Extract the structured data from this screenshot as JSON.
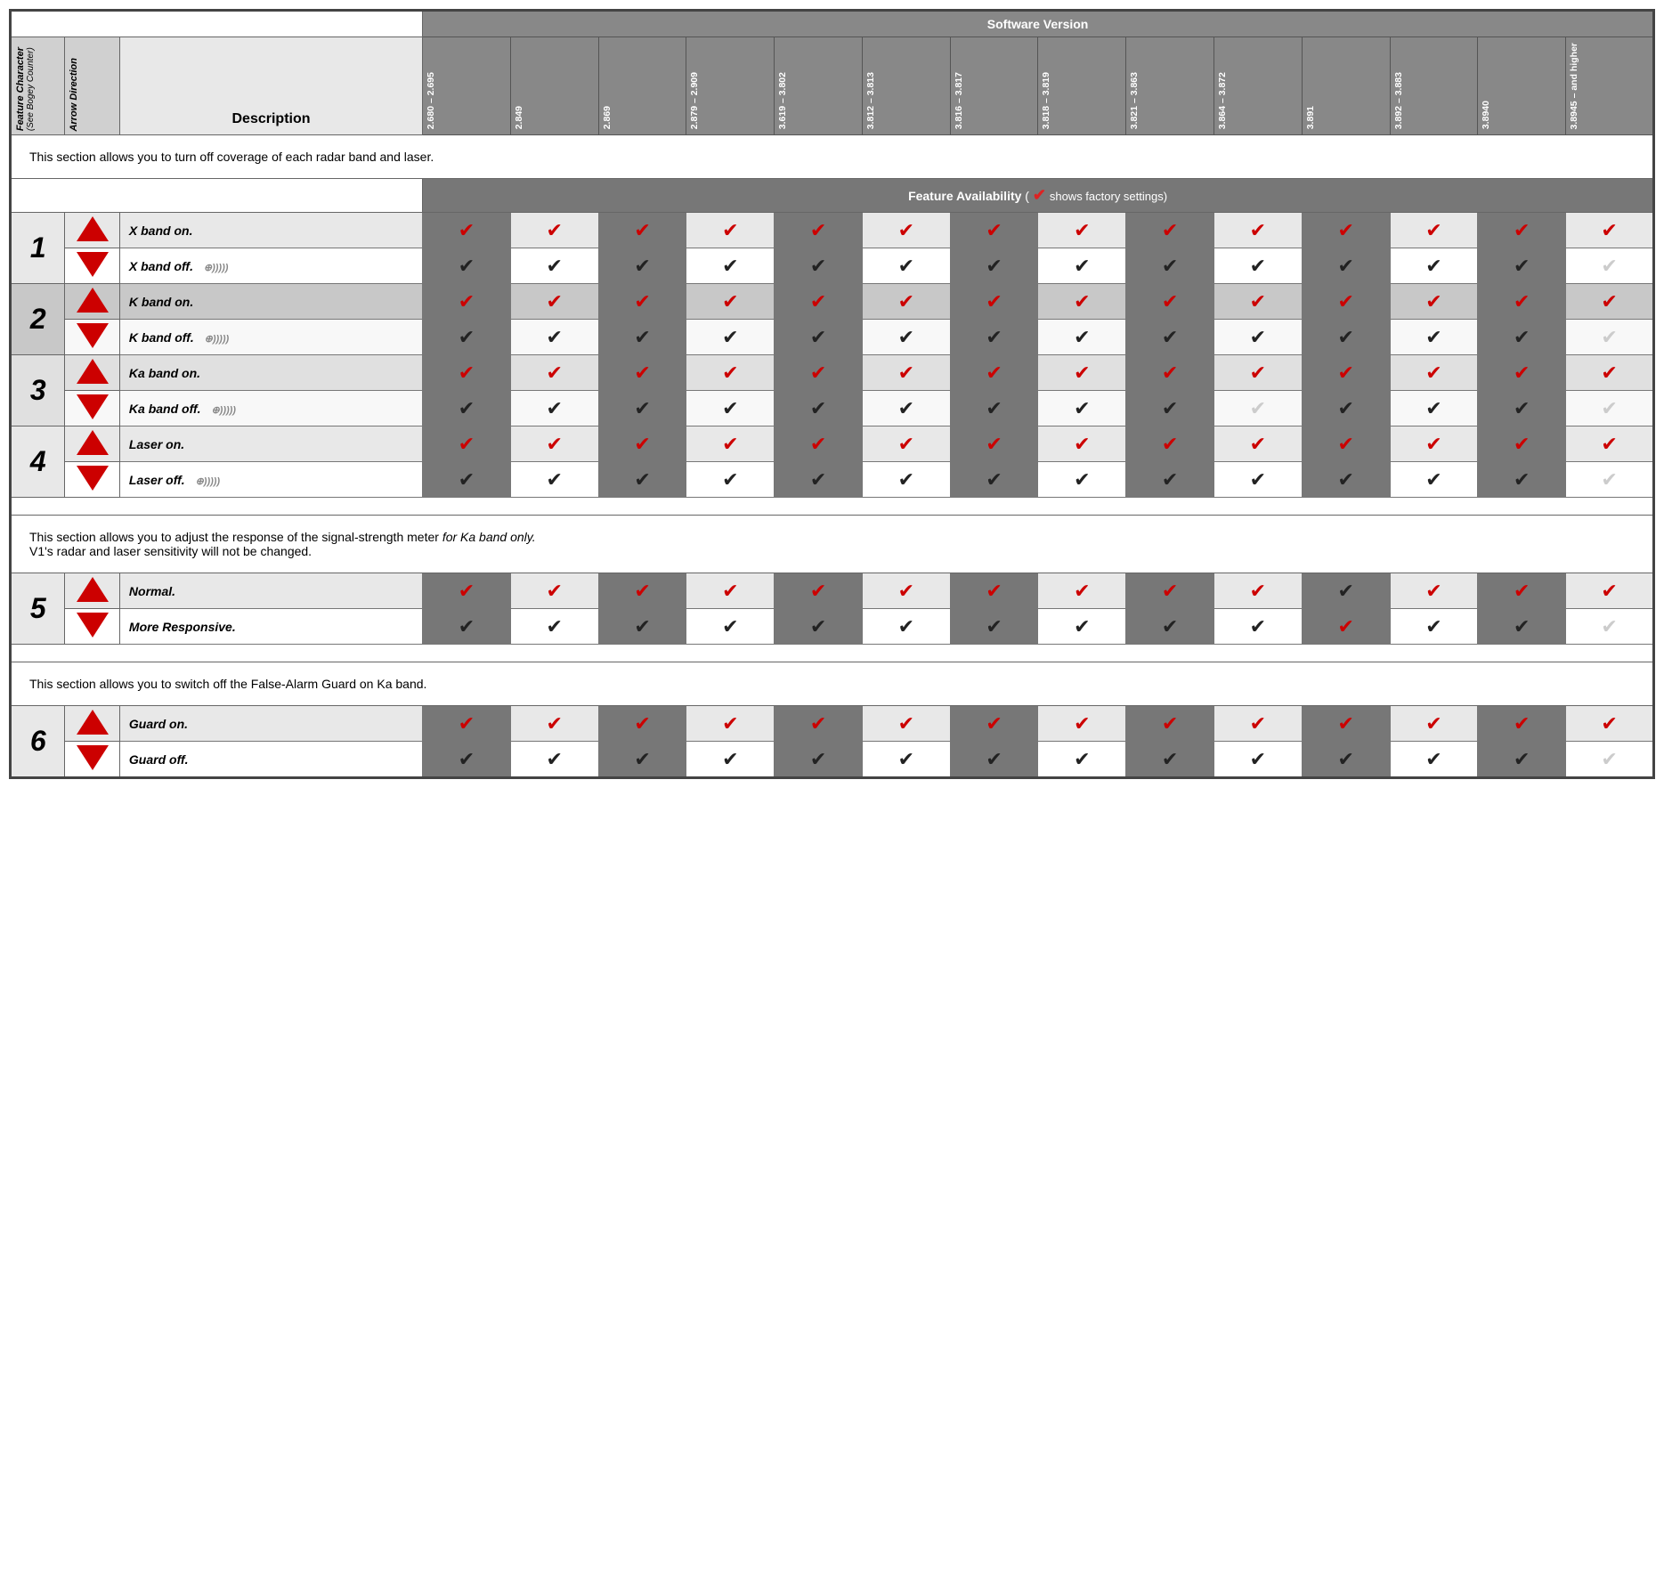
{
  "header": {
    "software_version_label": "Software Version",
    "feature_char_label": "Feature Character",
    "bogey_label": "(See Bogey Counter)",
    "arrow_direction_label": "Arrow Direction",
    "description_label": "Description",
    "versions": [
      "2.680 – 2.695",
      "2.849",
      "2.869",
      "2.879 – 2.909",
      "3.619 – 3.802",
      "3.812 – 3.813",
      "3.816 – 3.817",
      "3.818 – 3.819",
      "3.821 – 3.863",
      "3.864 – 3.872",
      "3.891",
      "3.892 – 3.883",
      "3.8940",
      "3.8945 – and higher"
    ],
    "feature_avail_label": "Feature Availability",
    "factory_settings_note": "( ✔ shows factory settings)"
  },
  "section1": {
    "intro": "This section allows you to turn off coverage of each radar band and laser.",
    "rows": [
      {
        "feature_num": "1",
        "feature_rowspan": 2,
        "arrow": "up",
        "desc": "X band on.",
        "checks": [
          "red",
          "red",
          "red",
          "red",
          "red",
          "red",
          "red",
          "red",
          "red",
          "red",
          "red",
          "red",
          "red",
          "red"
        ]
      },
      {
        "arrow": "down",
        "desc": "X band off.",
        "has_bogey": true,
        "checks": [
          "black",
          "black",
          "black",
          "black",
          "black",
          "black",
          "black",
          "black",
          "black",
          "black",
          "black",
          "black",
          "black",
          "white"
        ]
      },
      {
        "feature_num": "2",
        "feature_rowspan": 2,
        "arrow": "up",
        "desc": "K band on.",
        "checks": [
          "red",
          "red",
          "red",
          "red",
          "red",
          "red",
          "red",
          "red",
          "red",
          "red",
          "red",
          "red",
          "red",
          "red"
        ]
      },
      {
        "arrow": "down",
        "desc": "K band off.",
        "has_bogey": true,
        "checks": [
          "black",
          "black",
          "black",
          "black",
          "black",
          "black",
          "black",
          "black",
          "black",
          "black",
          "black",
          "black",
          "black",
          "white"
        ]
      },
      {
        "feature_num": "3",
        "feature_rowspan": 2,
        "arrow": "up",
        "desc": "Ka band on.",
        "checks": [
          "red",
          "red",
          "red",
          "red",
          "red",
          "red",
          "red",
          "red",
          "red",
          "red",
          "red",
          "red",
          "red",
          "red"
        ]
      },
      {
        "arrow": "down",
        "desc": "Ka band off.",
        "has_bogey": true,
        "checks": [
          "black",
          "black",
          "black",
          "black",
          "black",
          "black",
          "black",
          "black",
          "black",
          "black",
          "black",
          "black",
          "black",
          "white"
        ]
      },
      {
        "feature_num": "4",
        "feature_rowspan": 2,
        "arrow": "up",
        "desc": "Laser on.",
        "checks": [
          "red",
          "red",
          "red",
          "red",
          "red",
          "red",
          "red",
          "red",
          "red",
          "red",
          "red",
          "red",
          "red",
          "red"
        ]
      },
      {
        "arrow": "down",
        "desc": "Laser off.",
        "has_bogey": true,
        "checks": [
          "black",
          "black",
          "black",
          "black",
          "black",
          "black",
          "black",
          "black",
          "black",
          "black",
          "black",
          "black",
          "black",
          "white"
        ]
      }
    ]
  },
  "section2": {
    "intro_line1": "This section allows you to adjust the response of the signal-strength meter",
    "intro_italic": "for Ka band only.",
    "intro_line2": "V1's radar and laser sensitivity will not be changed.",
    "rows": [
      {
        "feature_num": "5",
        "feature_rowspan": 2,
        "arrow": "up",
        "desc": "Normal.",
        "checks": [
          "red",
          "red",
          "red",
          "red",
          "red",
          "red",
          "red",
          "red",
          "red",
          "red",
          "black",
          "red",
          "red",
          "red"
        ]
      },
      {
        "arrow": "down",
        "desc": "More Responsive.",
        "checks": [
          "black",
          "black",
          "black",
          "black",
          "black",
          "black",
          "black",
          "black",
          "black",
          "black",
          "red",
          "black",
          "black",
          "white"
        ]
      }
    ]
  },
  "section3": {
    "intro": "This section allows you to switch off the False-Alarm Guard on Ka band.",
    "rows": [
      {
        "feature_num": "6",
        "feature_rowspan": 2,
        "arrow": "up",
        "desc": "Guard on.",
        "checks": [
          "red",
          "red",
          "red",
          "red",
          "red",
          "red",
          "red",
          "red",
          "red",
          "red",
          "red",
          "red",
          "red",
          "red"
        ]
      },
      {
        "arrow": "down",
        "desc": "Guard off.",
        "checks": [
          "black",
          "black",
          "black",
          "black",
          "black",
          "black",
          "black",
          "black",
          "black",
          "black",
          "black",
          "black",
          "black",
          "white"
        ]
      }
    ]
  }
}
